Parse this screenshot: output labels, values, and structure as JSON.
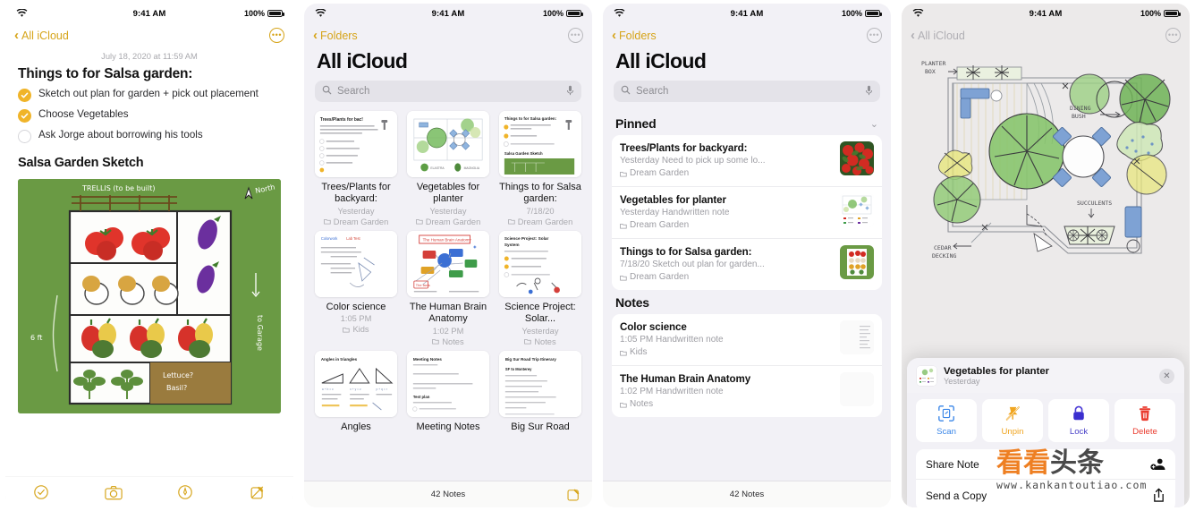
{
  "status_bar": {
    "time": "9:41 AM",
    "battery": "100%",
    "wifi_icon": "wifi-icon",
    "battery_icon": "battery-full-icon"
  },
  "panel1": {
    "nav": {
      "back_label": "All iCloud",
      "back_icon": "chevron-left-icon",
      "more_icon": "more-circle-icon"
    },
    "note": {
      "date": "July 18, 2020 at 11:59 AM",
      "heading": "Things to for Salsa garden:",
      "todos": [
        {
          "label": "Sketch out plan for garden + pick out placement",
          "checked": true
        },
        {
          "label": "Choose Vegetables",
          "checked": true
        },
        {
          "label": "Ask Jorge about borrowing his tools",
          "checked": false
        }
      ],
      "subheading": "Salsa Garden Sketch",
      "sketch_labels": {
        "trellis": "TRELLIS (to be built)",
        "north": "North",
        "width": "6 ft",
        "garage": "Garage",
        "herbs": "Lettuce?  Basil?"
      }
    },
    "toolbar": [
      {
        "name": "checklist-icon",
        "label": "Checklist"
      },
      {
        "name": "camera-icon",
        "label": "Camera"
      },
      {
        "name": "markup-pen-icon",
        "label": "Markup"
      },
      {
        "name": "compose-icon",
        "label": "New Note"
      }
    ]
  },
  "panel2": {
    "nav": {
      "back_label": "Folders",
      "back_icon": "chevron-left-icon",
      "more_icon": "more-circle-icon"
    },
    "title": "All iCloud",
    "search": {
      "placeholder": "Search",
      "icon": "search-icon",
      "mic_icon": "microphone-icon"
    },
    "gallery": [
      {
        "title": "Trees/Plants for backyard:",
        "date": "Yesterday",
        "folder": "Dream Garden",
        "pinned": true,
        "thumb": "note-checklist-thumb"
      },
      {
        "title": "Vegetables for planter",
        "date": "Yesterday",
        "folder": "Dream Garden",
        "pinned": false,
        "thumb": "garden-plan-thumb"
      },
      {
        "title": "Things to for Salsa garden:",
        "date": "7/18/20",
        "folder": "Dream Garden",
        "pinned": true,
        "thumb": "salsa-garden-thumb"
      },
      {
        "title": "Color science",
        "date": "1:05 PM",
        "folder": "Kids",
        "pinned": false,
        "thumb": "handwriting-thumb"
      },
      {
        "title": "The Human Brain Anatomy",
        "date": "1:02 PM",
        "folder": "Notes",
        "pinned": false,
        "thumb": "brain-diagram-thumb"
      },
      {
        "title": "Science Project: Solar...",
        "date": "Yesterday",
        "folder": "Notes",
        "pinned": false,
        "thumb": "solar-system-thumb"
      },
      {
        "title": "Angles",
        "date": "",
        "folder": "",
        "pinned": false,
        "thumb": "angles-thumb"
      },
      {
        "title": "Meeting Notes",
        "date": "",
        "folder": "",
        "pinned": false,
        "thumb": "meeting-notes-thumb"
      },
      {
        "title": "Big Sur Road",
        "date": "",
        "folder": "",
        "pinned": false,
        "thumb": "road-trip-thumb"
      }
    ],
    "bottom": {
      "count": "42 Notes",
      "compose_icon": "compose-icon"
    }
  },
  "panel3": {
    "nav": {
      "back_label": "Folders",
      "back_icon": "chevron-left-icon",
      "more_icon": "more-circle-icon"
    },
    "title": "All iCloud",
    "search": {
      "placeholder": "Search",
      "icon": "search-icon",
      "mic_icon": "microphone-icon"
    },
    "sections": [
      {
        "name": "Pinned",
        "chevron": "chevron-down-icon",
        "rows": [
          {
            "title": "Trees/Plants for backyard:",
            "meta": "Yesterday  Need to pick up some lo...",
            "folder": "Dream Garden",
            "thumb": "red-flowers-thumb"
          },
          {
            "title": "Vegetables for planter",
            "meta": "Yesterday  Handwritten note",
            "folder": "Dream Garden",
            "thumb": "garden-plan-thumb"
          },
          {
            "title": "Things to for Salsa garden:",
            "meta": "7/18/20  Sketch out plan for garden...",
            "folder": "Dream Garden",
            "thumb": "salsa-garden-thumb"
          }
        ]
      },
      {
        "name": "Notes",
        "chevron": "",
        "rows": [
          {
            "title": "Color science",
            "meta": "1:05 PM  Handwritten note",
            "folder": "Kids",
            "thumb": "handwriting-thumb"
          },
          {
            "title": "The Human Brain Anatomy",
            "meta": "1:02 PM  Handwritten note",
            "folder": "Notes",
            "thumb": "brain-diagram-thumb"
          }
        ]
      }
    ],
    "bottom": {
      "count": "42 Notes"
    }
  },
  "panel4": {
    "nav": {
      "back_label": "All iCloud",
      "back_icon": "chevron-left-icon",
      "more_icon": "more-circle-icon"
    },
    "canvas_labels": {
      "planter_box": "PLANTER BOX",
      "dining_bush": "DINING BUSH",
      "succulents": "SUCCULENTS",
      "cedar_decking": "CEDAR DECKING"
    },
    "sheet": {
      "note_title": "Vegetables for planter",
      "note_date": "Yesterday",
      "close_icon": "close-icon",
      "quick_actions": [
        {
          "label": "Scan",
          "icon": "scan-icon",
          "color": "#3a86e8"
        },
        {
          "label": "Unpin",
          "icon": "unpin-icon",
          "color": "#f0a51f"
        },
        {
          "label": "Lock",
          "icon": "lock-icon",
          "color": "#5856d6"
        },
        {
          "label": "Delete",
          "icon": "trash-icon",
          "color": "#ea3b2e"
        }
      ],
      "menu": [
        {
          "label": "Share Note",
          "icon": "share-person-icon"
        },
        {
          "label": "Send a Copy",
          "icon": "share-up-icon"
        }
      ]
    }
  },
  "watermark": {
    "chars": [
      "看",
      "看",
      "头",
      "条"
    ],
    "url": "www.kankantoutiao.com"
  },
  "colors": {
    "accent_gold": "#d6a419",
    "check_gold": "#f0b429",
    "bg_grey": "#f2f1f6",
    "sketch_green": "#6a9a44"
  }
}
